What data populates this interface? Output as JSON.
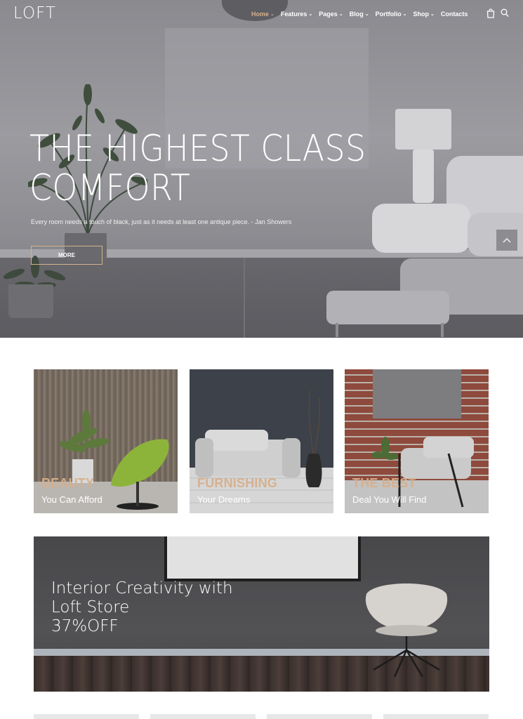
{
  "brand": {
    "logo": "LOFT"
  },
  "nav": {
    "items": [
      {
        "label": "Home",
        "active": true
      },
      {
        "label": "Features",
        "active": false
      },
      {
        "label": "Pages",
        "active": false
      },
      {
        "label": "Blog",
        "active": false
      },
      {
        "label": "Portfolio",
        "active": false
      },
      {
        "label": "Shop",
        "active": false
      },
      {
        "label": "Contacts",
        "active": false
      }
    ],
    "caret": "⌄",
    "icons": [
      "cart-icon",
      "search-icon"
    ]
  },
  "hero": {
    "title_line1": "THE HIGHEST CLASS",
    "title_line2": "COMFORT",
    "quote": "Every room needs a touch of black, just as it needs at least one antique piece. - Jan Showers",
    "button": "MORE"
  },
  "cards": [
    {
      "kicker": "BEAUTY",
      "subtitle": "You Can Afford"
    },
    {
      "kicker": "FURNISHING",
      "subtitle": "Your Dreams"
    },
    {
      "kicker": "THE BEST",
      "subtitle": "Deal You Will Find"
    }
  ],
  "banner": {
    "line1": "Interior Creativity with",
    "line2": "Loft Store",
    "line3": "37%OFF"
  },
  "colors": {
    "accent": "#d6b08c",
    "text_light": "#ffffff",
    "banner_bg": "#4d4d50"
  }
}
